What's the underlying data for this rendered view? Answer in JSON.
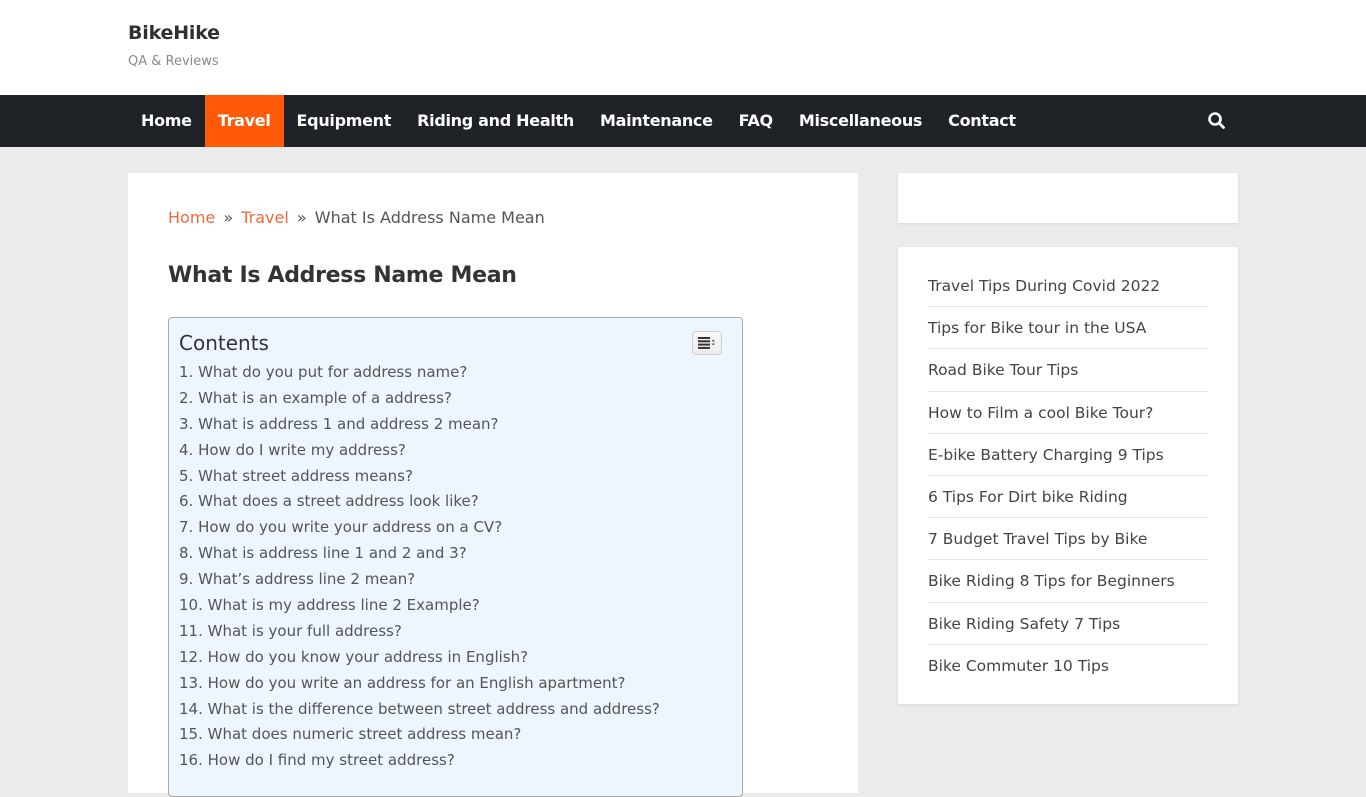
{
  "header": {
    "site_title": "BikeHike",
    "site_description": "QA & Reviews"
  },
  "nav": {
    "items": [
      {
        "label": "Home"
      },
      {
        "label": "Travel",
        "active": true
      },
      {
        "label": "Equipment"
      },
      {
        "label": "Riding and Health"
      },
      {
        "label": "Maintenance"
      },
      {
        "label": "FAQ"
      },
      {
        "label": "Miscellaneous"
      },
      {
        "label": "Contact"
      }
    ],
    "search_icon": "search-icon",
    "accent_color": "#ff5a0a"
  },
  "breadcrumb": {
    "home": "Home",
    "separator": "»",
    "category": "Travel",
    "current": "What Is Address Name Mean"
  },
  "article": {
    "title": "What Is Address Name Mean"
  },
  "toc": {
    "title": "Contents",
    "toggle_icon": "list-toggle-icon",
    "items": [
      "1. What do you put for address name?",
      "2. What is an example of a address?",
      "3. What is address 1 and address 2 mean?",
      "4. How do I write my address?",
      "5. What street address means?",
      "6. What does a street address look like?",
      "7. How do you write your address on a CV?",
      "8. What is address line 1 and 2 and 3?",
      "9. What’s address line 2 mean?",
      "10. What is my address line 2 Example?",
      "11. What is your full address?",
      "12. How do you know your address in English?",
      "13. How do you write an address for an English apartment?",
      "14. What is the difference between street address and address?",
      "15. What does numeric street address mean?",
      "16. How do I find my street address?"
    ]
  },
  "sidebar": {
    "recent_posts": [
      "Travel Tips During Covid 2022",
      "Tips for Bike tour in the USA",
      "Road Bike Tour Tips",
      "How to Film a cool Bike Tour?",
      "E-bike Battery Charging 9 Tips",
      "6 Tips For Dirt bike Riding",
      "7 Budget Travel Tips by Bike",
      "Bike Riding 8 Tips for Beginners",
      "Bike Riding Safety 7 Tips",
      "Bike Commuter 10 Tips"
    ]
  }
}
